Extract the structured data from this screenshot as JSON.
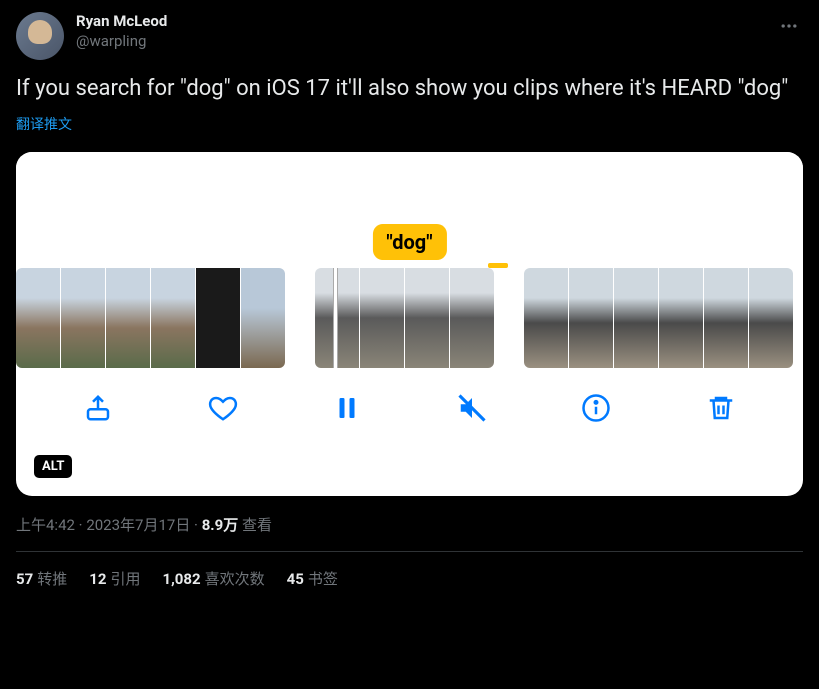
{
  "author": {
    "display_name": "Ryan McLeod",
    "handle": "@warpling"
  },
  "tweet_text": "If you search for \"dog\" on iOS 17 it'll also show you clips where it's HEARD \"dog\"",
  "translate_label": "翻译推文",
  "media": {
    "search_term": "\"dog\"",
    "alt_label": "ALT"
  },
  "meta": {
    "time": "上午4:42",
    "separator": " · ",
    "date": "2023年7月17日",
    "views_count": "8.9万",
    "views_label": " 查看"
  },
  "stats": {
    "retweets_count": "57",
    "retweets_label": "转推",
    "quotes_count": "12",
    "quotes_label": "引用",
    "likes_count": "1,082",
    "likes_label": "喜欢次数",
    "bookmarks_count": "45",
    "bookmarks_label": "书签"
  }
}
